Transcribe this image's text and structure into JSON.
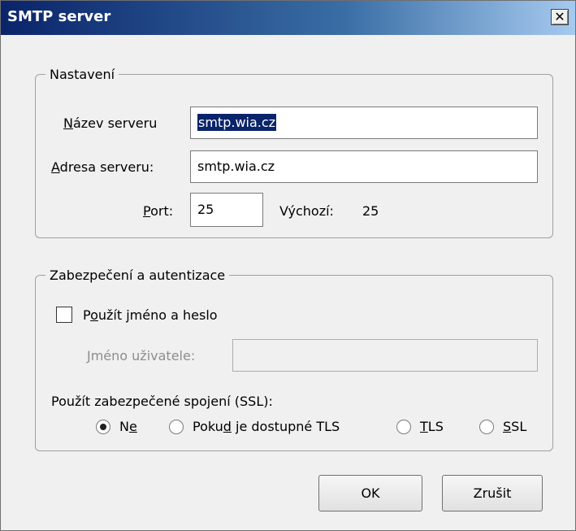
{
  "window": {
    "title": "SMTP server",
    "close_symbol": "✕"
  },
  "settings_group": {
    "legend": "Nastavení",
    "server_name": {
      "label_mnemonic": "N",
      "label_rest": "ázev serveru",
      "value": "smtp.wia.cz"
    },
    "server_address": {
      "label_mnemonic": "A",
      "label_rest": "dresa serveru:",
      "value": "smtp.wia.cz"
    },
    "port": {
      "label_mnemonic": "P",
      "label_rest": "ort:",
      "value": "25"
    },
    "default": {
      "label": "Výchozí:",
      "value": "25"
    }
  },
  "security_group": {
    "legend": "Zabezpečení a autentizace",
    "use_credentials": {
      "label_before": "P",
      "label_mnemonic": "o",
      "label_after": "užít jméno a heslo",
      "checked": false
    },
    "username": {
      "label_mnemonic": "J",
      "label_rest": "méno uživatele:",
      "value": ""
    },
    "ssl_label": "Použít zabezpečené spojení (SSL):",
    "ssl_options": [
      {
        "before": "N",
        "mnemonic": "e",
        "after": "",
        "checked": true
      },
      {
        "before": "Poku",
        "mnemonic": "d",
        "after": " je dostupné TLS",
        "checked": false
      },
      {
        "before": "",
        "mnemonic": "T",
        "after": "LS",
        "checked": false
      },
      {
        "before": "",
        "mnemonic": "S",
        "after": "SL",
        "checked": false
      }
    ]
  },
  "buttons": {
    "ok": "OK",
    "cancel": "Zrušit"
  }
}
